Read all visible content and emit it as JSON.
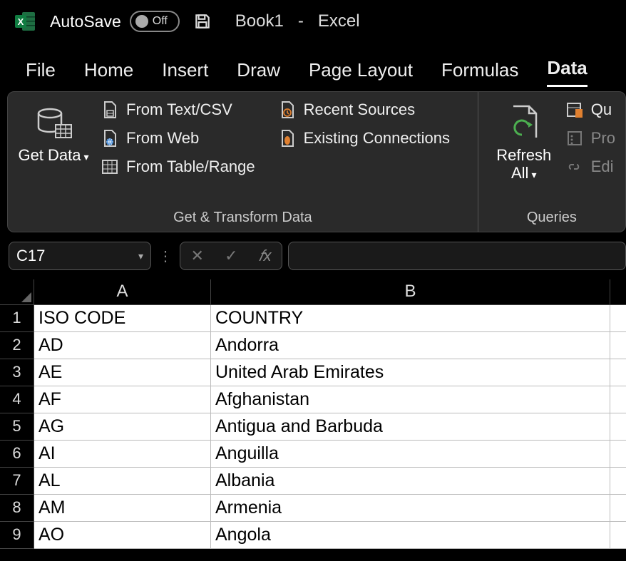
{
  "titlebar": {
    "autosave_label": "AutoSave",
    "autosave_state": "Off",
    "doc_name": "Book1",
    "separator": "-",
    "app_name": "Excel"
  },
  "tabs": [
    "File",
    "Home",
    "Insert",
    "Draw",
    "Page Layout",
    "Formulas",
    "Data"
  ],
  "active_tab_index": 6,
  "ribbon": {
    "group1": {
      "label": "Get & Transform Data",
      "get_data": "Get Data",
      "from_text_csv": "From Text/CSV",
      "from_web": "From Web",
      "from_table_range": "From Table/Range",
      "recent_sources": "Recent Sources",
      "existing_connections": "Existing Connections"
    },
    "group2": {
      "label": "Queries",
      "refresh_all": "Refresh All",
      "queries_btn": "Qu",
      "properties_btn": "Pro",
      "edit_links_btn": "Edi"
    }
  },
  "formula_bar": {
    "name_box": "C17",
    "formula": ""
  },
  "grid": {
    "columns": [
      "A",
      "B"
    ],
    "rows": [
      {
        "n": "1",
        "a": "ISO CODE",
        "b": "COUNTRY"
      },
      {
        "n": "2",
        "a": "AD",
        "b": "Andorra"
      },
      {
        "n": "3",
        "a": "AE",
        "b": "United Arab Emirates"
      },
      {
        "n": "4",
        "a": "AF",
        "b": "Afghanistan"
      },
      {
        "n": "5",
        "a": "AG",
        "b": "Antigua and Barbuda"
      },
      {
        "n": "6",
        "a": "AI",
        "b": "Anguilla"
      },
      {
        "n": "7",
        "a": "AL",
        "b": "Albania"
      },
      {
        "n": "8",
        "a": "AM",
        "b": "Armenia"
      },
      {
        "n": "9",
        "a": "AO",
        "b": "Angola"
      }
    ]
  }
}
